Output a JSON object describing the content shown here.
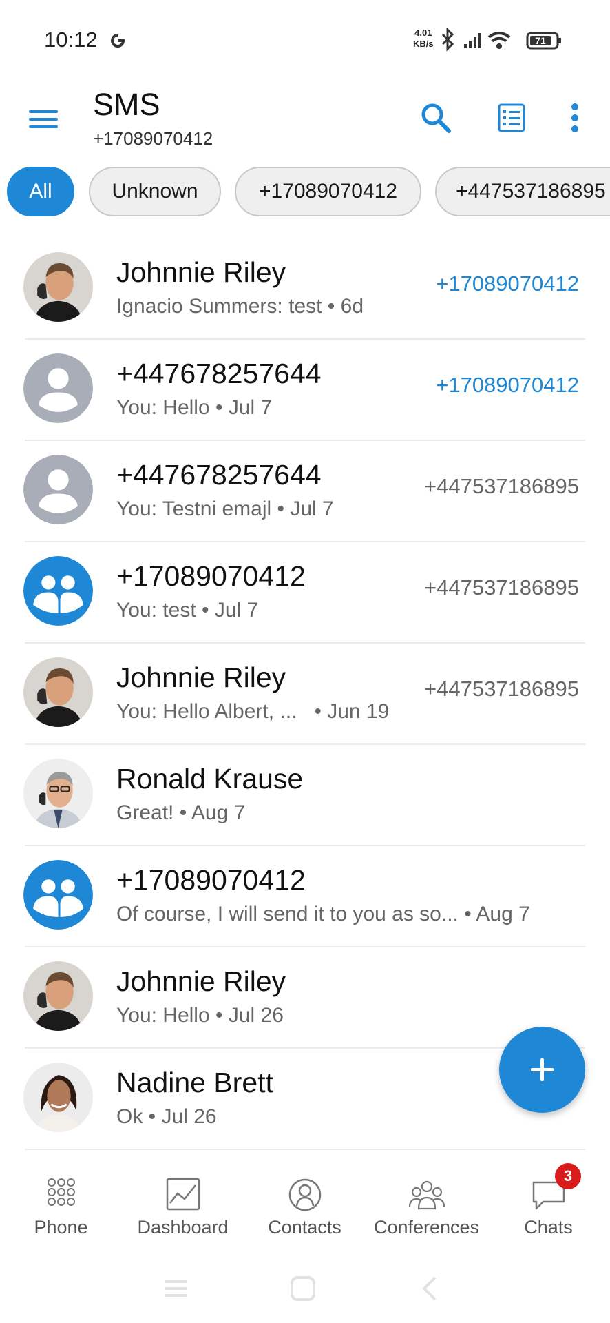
{
  "status_bar": {
    "time": "10:12",
    "net_speed_value": "4.01",
    "net_speed_unit": "KB/s",
    "battery": "71"
  },
  "app_bar": {
    "title": "SMS",
    "subtitle": "+17089070412"
  },
  "filters": [
    {
      "label": "All",
      "active": true
    },
    {
      "label": "Unknown",
      "active": false
    },
    {
      "label": "+17089070412",
      "active": false
    },
    {
      "label": "+447537186895",
      "active": false
    }
  ],
  "conversations": [
    {
      "name": "Johnnie Riley",
      "preview": "Ignacio Summers: test",
      "date": "6d",
      "line": "+17089070412",
      "line_highlight": true,
      "avatar": "photo-man-phone"
    },
    {
      "name": "+447678257644",
      "preview": "You: Hello",
      "date": "Jul 7",
      "line": "+17089070412",
      "line_highlight": true,
      "avatar": "default-person"
    },
    {
      "name": "+447678257644",
      "preview": "You: Testni emajl",
      "date": "Jul 7",
      "line": "+447537186895",
      "line_highlight": false,
      "avatar": "default-person"
    },
    {
      "name": "+17089070412",
      "preview": "You: test",
      "date": "Jul 7",
      "line": "+447537186895",
      "line_highlight": false,
      "avatar": "group"
    },
    {
      "name": "Johnnie Riley",
      "preview": "You: Hello Albert, ...",
      "date": "Jun 19",
      "line": "+447537186895",
      "line_highlight": false,
      "avatar": "photo-man-phone"
    },
    {
      "name": "Ronald Krause",
      "preview": "Great!",
      "date": "Aug 7",
      "line": "",
      "line_highlight": false,
      "avatar": "photo-man-glasses"
    },
    {
      "name": "+17089070412",
      "preview": "Of course, I will send it to you as so...",
      "date": "Aug 7",
      "line": "",
      "line_highlight": false,
      "avatar": "group"
    },
    {
      "name": "Johnnie Riley",
      "preview": "You: Hello",
      "date": "Jul 26",
      "line": "",
      "line_highlight": false,
      "avatar": "photo-man-phone"
    },
    {
      "name": "Nadine Brett",
      "preview": "Ok",
      "date": "Jul 26",
      "line": "",
      "line_highlight": false,
      "avatar": "photo-woman"
    }
  ],
  "bottom_nav": [
    {
      "label": "Phone",
      "icon": "dialpad-icon"
    },
    {
      "label": "Dashboard",
      "icon": "chart-icon"
    },
    {
      "label": "Contacts",
      "icon": "contact-icon"
    },
    {
      "label": "Conferences",
      "icon": "people-icon"
    },
    {
      "label": "Chats",
      "icon": "chat-icon",
      "badge": "3"
    }
  ],
  "colors": {
    "accent": "#1e88d6",
    "badge": "#d81b1b"
  }
}
